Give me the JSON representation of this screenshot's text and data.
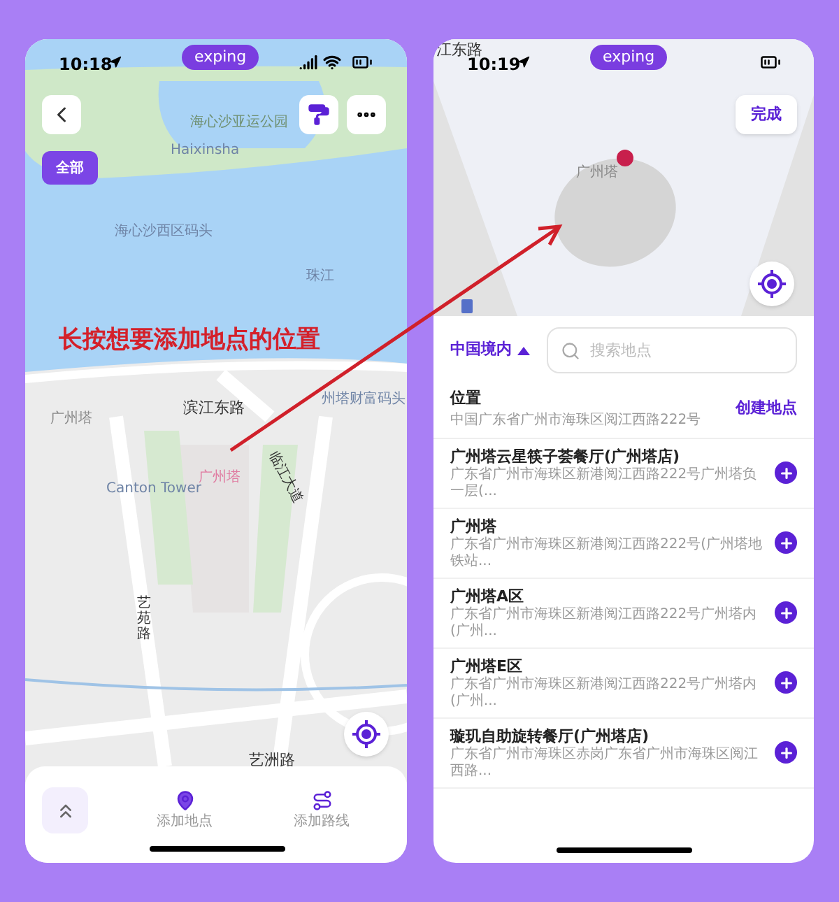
{
  "annotation": "长按想要添加地点的位置",
  "left_phone": {
    "status_bar": {
      "time": "10:18"
    },
    "app_badge": "exping",
    "filter_button": "全部",
    "map_labels": [
      {
        "text": "海心沙亚运公园",
        "kind": "park"
      },
      {
        "text": "Haixinsha",
        "kind": "water"
      },
      {
        "text": "海心沙西区码头",
        "kind": "water"
      },
      {
        "text": "珠江",
        "kind": "water"
      },
      {
        "text": "州塔财富码头",
        "kind": "water"
      },
      {
        "text": "滨江东路",
        "kind": "road"
      },
      {
        "text": "广州塔",
        "kind": "poi"
      },
      {
        "text": "Canton Tower",
        "kind": "water"
      },
      {
        "text": "广州塔",
        "kind": "landmark"
      },
      {
        "text": "临江大道",
        "kind": "slanted"
      },
      {
        "text": "艺苑路",
        "kind": "vertical"
      },
      {
        "text": "艺洲路",
        "kind": "road"
      }
    ],
    "bottom_bar": {
      "items": [
        {
          "label": "添加地点",
          "kind": "pin"
        },
        {
          "label": "添加路线",
          "kind": "route"
        }
      ]
    }
  },
  "right_phone": {
    "status_bar": {
      "time": "10:19"
    },
    "app_badge": "exping",
    "done_button": "完成",
    "map_labels": [
      {
        "text": "江东路",
        "kind": "road"
      },
      {
        "text": "广州塔",
        "kind": "poi"
      }
    ],
    "region_selector": "中国境内",
    "search": {
      "placeholder": "搜索地点"
    },
    "location": {
      "title": "位置",
      "address": "中国广东省广州市海珠区阅江西路222号",
      "create_link": "创建地点"
    },
    "results": [
      {
        "name": "广州塔云星筷子荟餐厅(广州塔店)",
        "address": "广东省广州市海珠区新港阅江西路222号广州塔负一层(..."
      },
      {
        "name": "广州塔",
        "address": "广东省广州市海珠区新港阅江西路222号(广州塔地铁站..."
      },
      {
        "name": "广州塔A区",
        "address": "广东省广州市海珠区新港阅江西路222号广州塔内(广州..."
      },
      {
        "name": "广州塔E区",
        "address": "广东省广州市海珠区新港阅江西路222号广州塔内(广州..."
      },
      {
        "name": "璇玑自助旋转餐厅(广州塔店)",
        "address": "广东省广州市海珠区赤岗广东省广州市海珠区阅江西路..."
      }
    ]
  }
}
